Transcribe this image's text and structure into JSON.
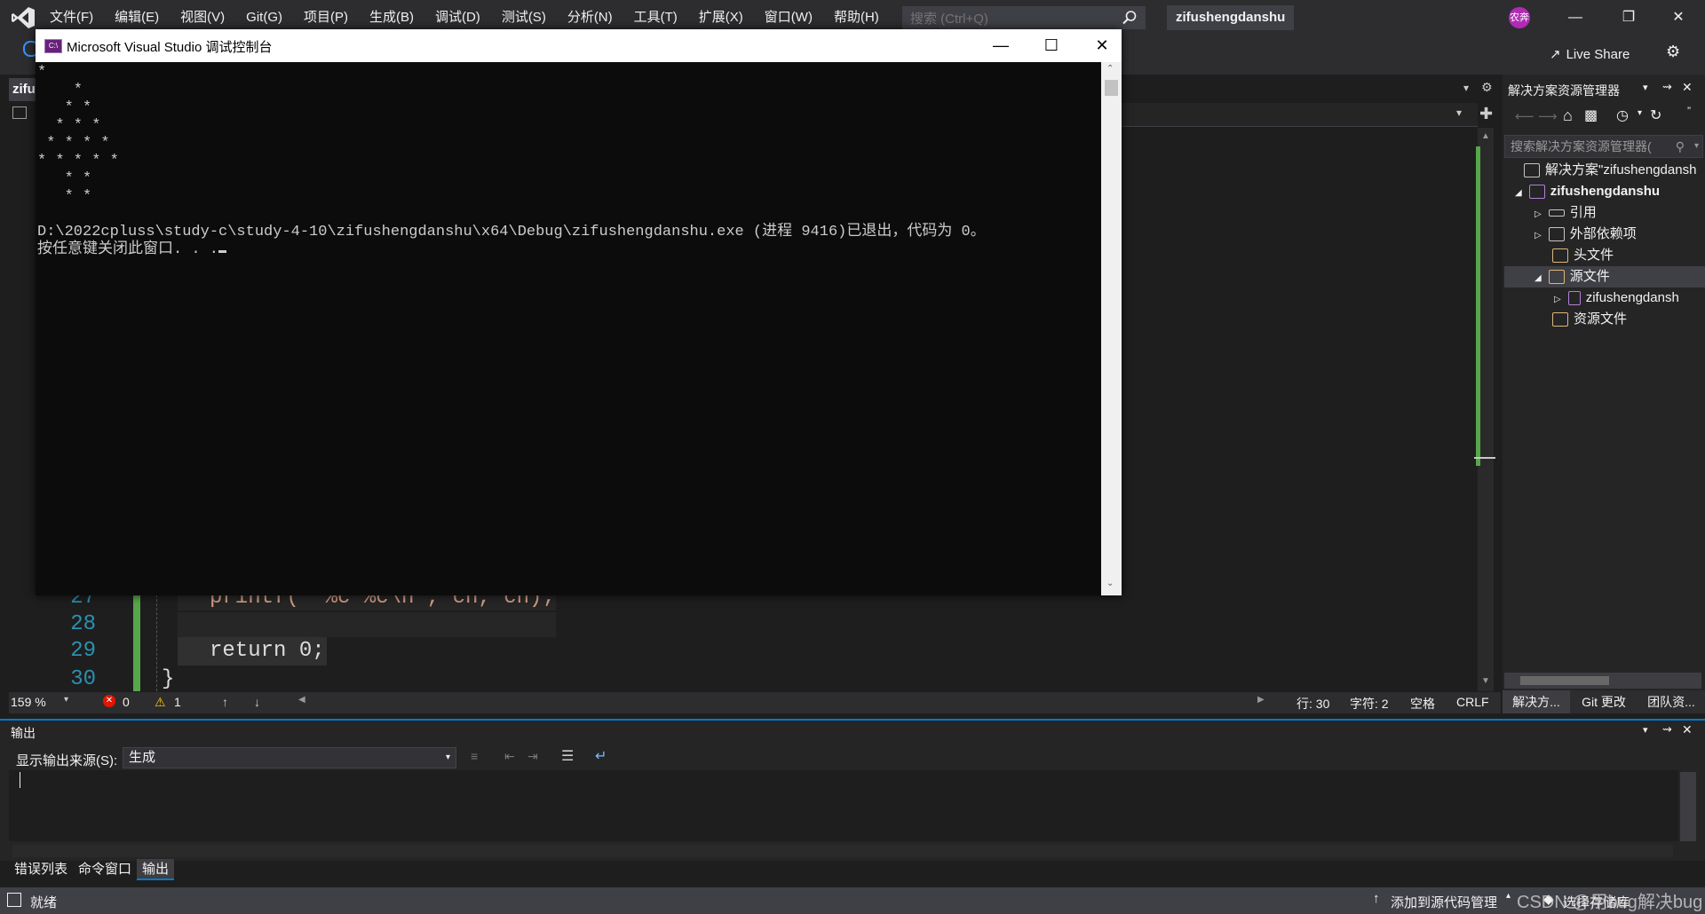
{
  "menu": [
    "文件(F)",
    "编辑(E)",
    "视图(V)",
    "Git(G)",
    "项目(P)",
    "生成(B)",
    "调试(D)",
    "测试(S)",
    "分析(N)",
    "工具(T)",
    "扩展(X)",
    "窗口(W)",
    "帮助(H)"
  ],
  "search": {
    "placeholder": "搜索 (Ctrl+Q)"
  },
  "solution_name": "zifushengdanshu",
  "avatar_text": "农奔",
  "live_share": "Live Share",
  "editor": {
    "tab_label": "zifu",
    "lines": [
      {
        "num": "27",
        "code": "printf(\"   %c %c\\n\", ch, ch);"
      },
      {
        "num": "28",
        "code": ""
      },
      {
        "num": "29",
        "code": "return 0;"
      },
      {
        "num": "30",
        "code": "}"
      }
    ]
  },
  "editor_status": {
    "zoom": "159 %",
    "errors": "0",
    "warnings": "1",
    "line": "行: 30",
    "char": "字符: 2",
    "spacing": "空格",
    "eol": "CRLF"
  },
  "solution_explorer": {
    "title": "解决方案资源管理器",
    "search_placeholder": "搜索解决方案资源管理器(",
    "items": [
      {
        "label": "解决方案\"zifushengdansh",
        "indent": 0,
        "expander": "",
        "icon": "solution-icon"
      },
      {
        "label": "zifushengdanshu",
        "indent": 1,
        "expander": "◢",
        "icon": "project-icon",
        "bold": true
      },
      {
        "label": "引用",
        "indent": 2,
        "expander": "▷",
        "icon": "references-icon"
      },
      {
        "label": "外部依赖项",
        "indent": 2,
        "expander": "▷",
        "icon": "dependencies-icon"
      },
      {
        "label": "头文件",
        "indent": 2,
        "expander": "",
        "icon": "folder-icon"
      },
      {
        "label": "源文件",
        "indent": 2,
        "expander": "◢",
        "icon": "folder-open-icon",
        "selected": true
      },
      {
        "label": "zifushengdansh",
        "indent": 3,
        "expander": "▷",
        "icon": "cpp-file-icon"
      },
      {
        "label": "资源文件",
        "indent": 2,
        "expander": "",
        "icon": "folder-icon"
      }
    ],
    "tabs": [
      "解决方...",
      "Git 更改",
      "团队资..."
    ]
  },
  "output": {
    "title": "输出",
    "source_label": "显示输出来源(S):",
    "source_value": "生成"
  },
  "bottom_tabs": [
    "错误列表",
    "命令窗口",
    "输出"
  ],
  "status_bar": {
    "ready": "就绪",
    "add_source": "添加到源代码管理",
    "select_repo": "选择存储库",
    "watermark": "CSDN @用bug解决bug"
  },
  "console": {
    "title": "Microsoft Visual Studio 调试控制台",
    "lines": [
      "*",
      "    *",
      "   * *",
      "  * * *",
      " * * * *",
      "* * * * *",
      "   * *",
      "   * *",
      "",
      "D:\\2022cpluss\\study-c\\study-4-10\\zifushengdanshu\\x64\\Debug\\zifushengdanshu.exe (进程 9416)已退出，代码为 0。",
      "按任意键关闭此窗口. . ."
    ]
  },
  "colors": {
    "accent": "#007acc",
    "change_bar": "#57a64a",
    "line_number": "#2b91af",
    "avatar": "#b02bb3"
  }
}
